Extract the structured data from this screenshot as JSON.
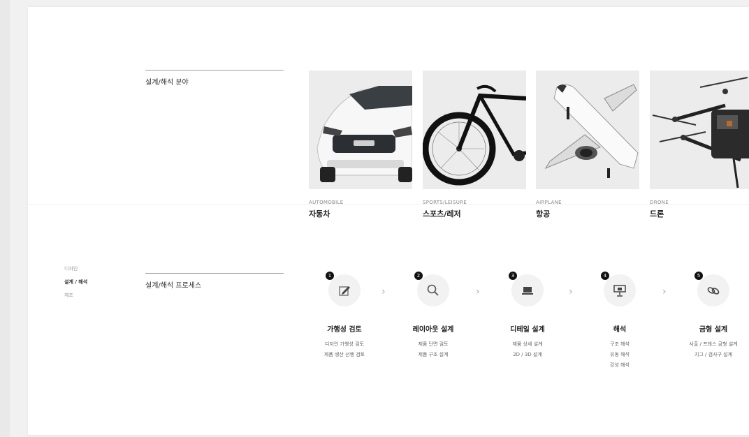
{
  "side_nav": [
    "디자인",
    "설계 / 해석",
    "제조"
  ],
  "side_nav_active": 1,
  "sections": {
    "fields_title": "설계/해석 분야",
    "process_title": "설계/해석 프로세스"
  },
  "fields": [
    {
      "en": "AUTOMOBILE",
      "ko": "자동차",
      "icon": "car-image"
    },
    {
      "en": "SPORTS/LEISURE",
      "ko": "스포츠/레저",
      "icon": "bicycle-image"
    },
    {
      "en": "AIRPLANE",
      "ko": "항공",
      "icon": "airplane-image"
    },
    {
      "en": "DRONE",
      "ko": "드론",
      "icon": "drone-image"
    }
  ],
  "process": [
    {
      "num": "1",
      "icon": "pencil-icon",
      "title": "가행성 검토",
      "desc": [
        "디자인 가행성 검토",
        "제품 생산 선행 검토"
      ]
    },
    {
      "num": "2",
      "icon": "search-icon",
      "title": "레이아웃 설계",
      "desc": [
        "제품 단면 검토",
        "제품 구조 설계"
      ]
    },
    {
      "num": "3",
      "icon": "laptop-icon",
      "title": "디테일 설계",
      "desc": [
        "제품 상세 설계",
        "2D / 3D 설계"
      ]
    },
    {
      "num": "4",
      "icon": "presentation-icon",
      "title": "해석",
      "desc": [
        "구조 해석",
        "유동 해석",
        "강성 해석"
      ]
    },
    {
      "num": "5",
      "icon": "link-icon",
      "title": "금형 설계",
      "desc": [
        "사출 / 프레스 금형 설계",
        "지그 / 검사구 설계"
      ]
    }
  ]
}
